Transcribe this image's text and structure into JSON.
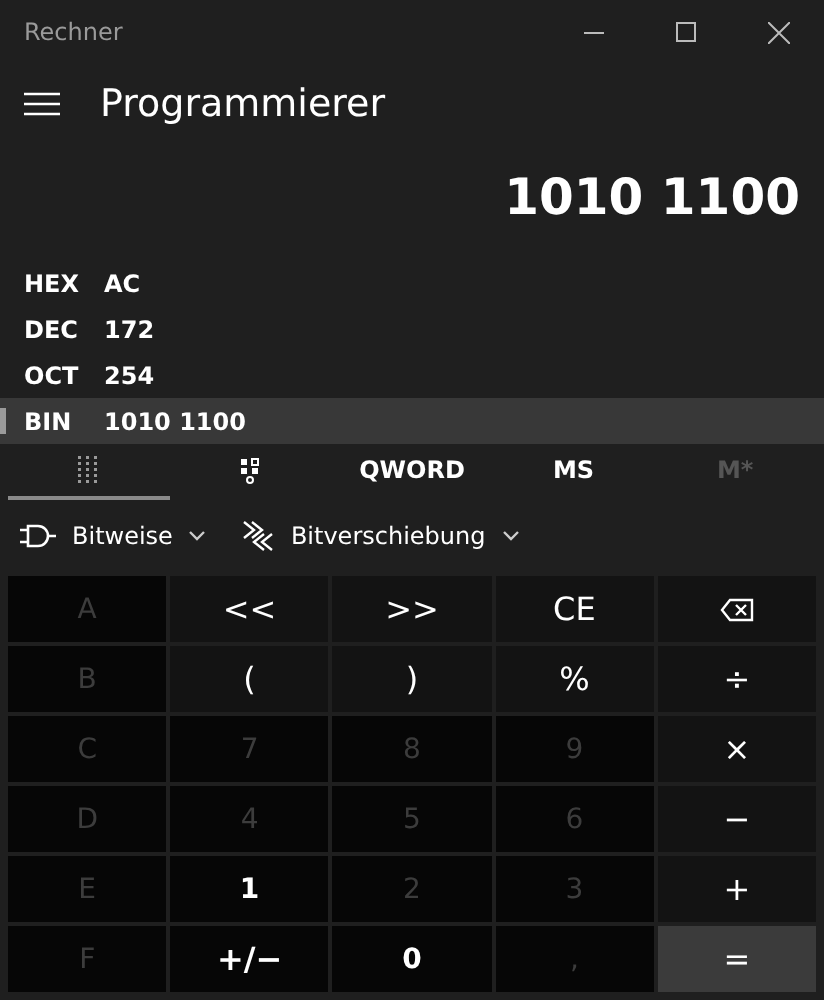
{
  "window": {
    "title": "Rechner"
  },
  "header": {
    "title": "Programmierer"
  },
  "display": {
    "value": "1010 1100"
  },
  "radix": [
    {
      "name": "HEX",
      "value": "AC",
      "selected": false
    },
    {
      "name": "DEC",
      "value": "172",
      "selected": false
    },
    {
      "name": "OCT",
      "value": "254",
      "selected": false
    },
    {
      "name": "BIN",
      "value": "1010 1100",
      "selected": true
    }
  ],
  "tabs": [
    {
      "kind": "keypad",
      "selected": true,
      "disabled": false
    },
    {
      "kind": "bits",
      "selected": false,
      "disabled": false
    },
    {
      "kind": "text",
      "label": "QWORD",
      "selected": false,
      "disabled": false
    },
    {
      "kind": "text",
      "label": "MS",
      "selected": false,
      "disabled": false
    },
    {
      "kind": "text",
      "label": "M*",
      "selected": false,
      "disabled": true
    }
  ],
  "toolbar": [
    {
      "kind": "gate",
      "label": "Bitweise"
    },
    {
      "kind": "shift",
      "label": "Bitverschiebung"
    }
  ],
  "keys": [
    {
      "kind": "digit",
      "label": "A",
      "disabled": true
    },
    {
      "kind": "op",
      "label": "<<",
      "disabled": false
    },
    {
      "kind": "op",
      "label": ">>",
      "disabled": false
    },
    {
      "kind": "op",
      "label": "CE",
      "disabled": false
    },
    {
      "kind": "backspace",
      "disabled": false
    },
    {
      "kind": "digit",
      "label": "B",
      "disabled": true
    },
    {
      "kind": "op",
      "label": "(",
      "disabled": false
    },
    {
      "kind": "op",
      "label": ")",
      "disabled": false
    },
    {
      "kind": "op",
      "label": "%",
      "disabled": false
    },
    {
      "kind": "op",
      "label": "÷",
      "disabled": false
    },
    {
      "kind": "digit",
      "label": "C",
      "disabled": true
    },
    {
      "kind": "digit",
      "label": "7",
      "disabled": true
    },
    {
      "kind": "digit",
      "label": "8",
      "disabled": true
    },
    {
      "kind": "digit",
      "label": "9",
      "disabled": true
    },
    {
      "kind": "op",
      "label": "×",
      "disabled": false
    },
    {
      "kind": "digit",
      "label": "D",
      "disabled": true
    },
    {
      "kind": "digit",
      "label": "4",
      "disabled": true
    },
    {
      "kind": "digit",
      "label": "5",
      "disabled": true
    },
    {
      "kind": "digit",
      "label": "6",
      "disabled": true
    },
    {
      "kind": "op",
      "label": "−",
      "disabled": false
    },
    {
      "kind": "digit",
      "label": "E",
      "disabled": true
    },
    {
      "kind": "digit",
      "label": "1",
      "disabled": false
    },
    {
      "kind": "digit",
      "label": "2",
      "disabled": true
    },
    {
      "kind": "digit",
      "label": "3",
      "disabled": true
    },
    {
      "kind": "op",
      "label": "+",
      "disabled": false
    },
    {
      "kind": "digit",
      "label": "F",
      "disabled": true
    },
    {
      "kind": "digit",
      "label": "+/−",
      "disabled": false
    },
    {
      "kind": "digit",
      "label": "0",
      "disabled": false
    },
    {
      "kind": "digit",
      "label": ",",
      "disabled": true
    },
    {
      "kind": "equals",
      "label": "=",
      "disabled": false
    }
  ]
}
